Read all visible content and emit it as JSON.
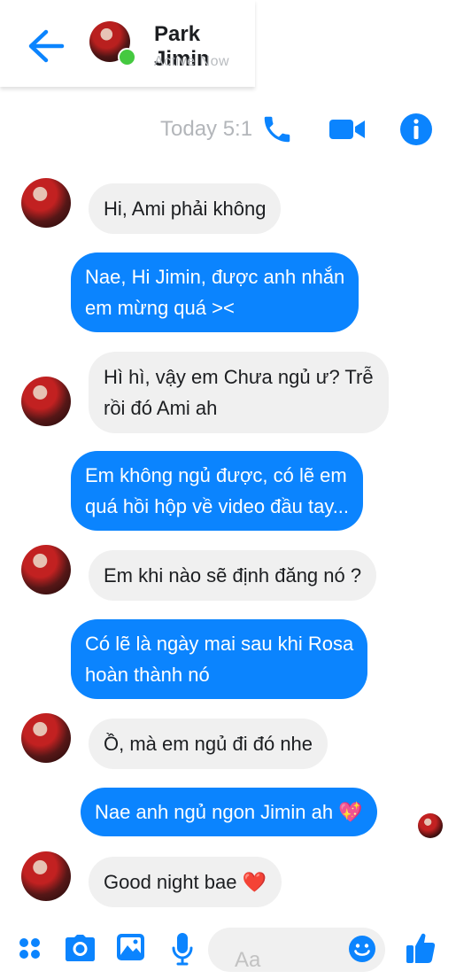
{
  "header": {
    "contact_name": "Park Jimin",
    "status": "Active Now",
    "timestamp": "Today 5:1",
    "accent": "#0b84fe",
    "online_color": "#45c940"
  },
  "messages": [
    {
      "sender": "Park Jimin",
      "direction": "incoming",
      "text_lines": [
        "Hi, Ami phải không"
      ]
    },
    {
      "sender": "me",
      "direction": "outgoing",
      "text_lines": [
        "Nae, Hi Jimin, được anh nhắn",
        "em mừng quá ><"
      ]
    },
    {
      "sender": "Park Jimin",
      "direction": "incoming",
      "text_lines": [
        "Hì hì, vậy em Chưa ngủ ư? Trễ",
        "rồi đó Ami ah"
      ]
    },
    {
      "sender": "me",
      "direction": "outgoing",
      "text_lines": [
        "Em không ngủ được, có lẽ em",
        "quá hồi hộp về video đầu tay..."
      ]
    },
    {
      "sender": "Park Jimin",
      "direction": "incoming",
      "text_lines": [
        "Em khi nào sẽ định đăng nó ?"
      ]
    },
    {
      "sender": "me",
      "direction": "outgoing",
      "text_lines": [
        "Có lẽ là ngày mai sau khi Rosa",
        "hoàn thành nó"
      ]
    },
    {
      "sender": "Park Jimin",
      "direction": "incoming",
      "text_lines": [
        "Ồ, mà em ngủ đi đó nhe"
      ]
    },
    {
      "sender": "me",
      "direction": "outgoing",
      "text_lines": [
        "Nae anh ngủ ngon Jimin ah 💖"
      ]
    },
    {
      "sender": "Park Jimin",
      "direction": "incoming",
      "text_lines": [
        "Good night bae ❤️"
      ]
    }
  ],
  "composer": {
    "placeholder": "Aa",
    "icons": [
      "apps-icon",
      "camera-icon",
      "gallery-icon",
      "microphone-icon",
      "emoji-icon",
      "thumbs-up-icon"
    ]
  },
  "colors": {
    "incoming_bubble": "#f0f0f0",
    "outgoing_bubble": "#0b84fe"
  }
}
